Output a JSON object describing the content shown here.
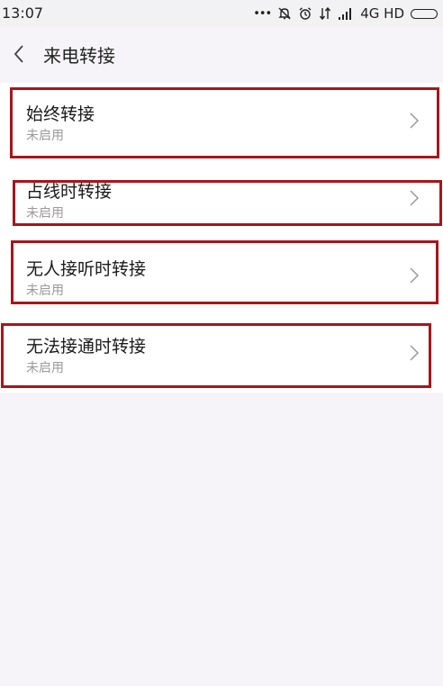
{
  "status_bar": {
    "time": "13:07",
    "dots": "•••",
    "network": "4G HD"
  },
  "header": {
    "title": "来电转接"
  },
  "settings": {
    "items": [
      {
        "label": "始终转接",
        "status": "未启用"
      },
      {
        "label": "占线时转接",
        "status": "未启用"
      },
      {
        "label": "无人接听时转接",
        "status": "未启用"
      },
      {
        "label": "无法接通时转接",
        "status": "未启用"
      }
    ]
  },
  "colors": {
    "highlight": "#a8151b",
    "background": "#f6f4f8",
    "card": "#ffffff"
  },
  "icons": {
    "back": "chevron-left-icon",
    "item": "chevron-right-icon"
  }
}
